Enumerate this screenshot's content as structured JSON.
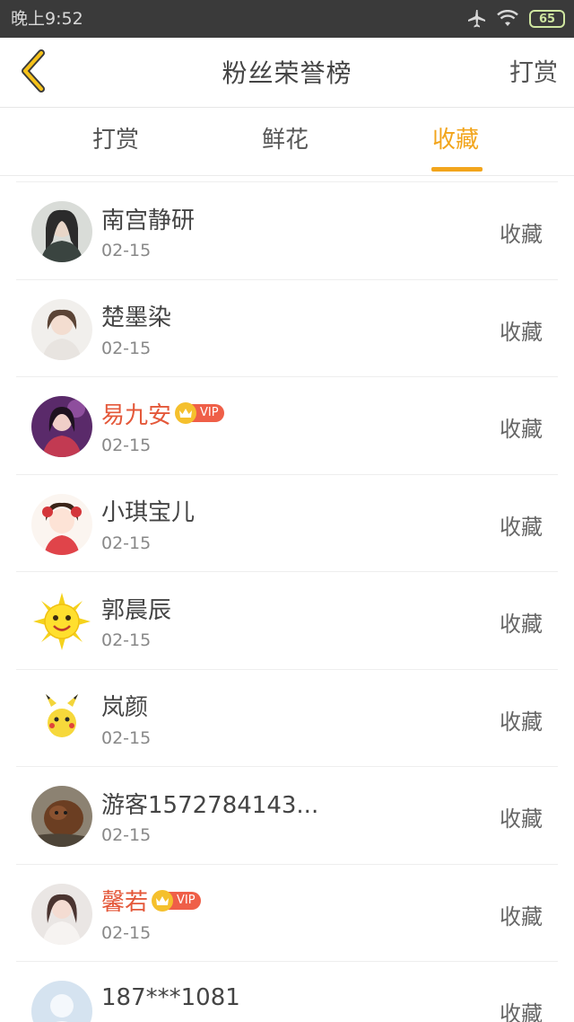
{
  "status_bar": {
    "time": "晚上9:52",
    "battery": "65"
  },
  "header": {
    "title": "粉丝荣誉榜",
    "action_label": "打赏"
  },
  "tabs": [
    {
      "label": "打赏",
      "active": false
    },
    {
      "label": "鲜花",
      "active": false
    },
    {
      "label": "收藏",
      "active": true
    }
  ],
  "colors": {
    "accent": "#f2a51c",
    "vip_name": "#e4583a",
    "vip_badge": "#ef5f48"
  },
  "rows": [
    {
      "name": "南宫静研",
      "date": "02-15",
      "action": "收藏",
      "vip": false
    },
    {
      "name": "楚墨染",
      "date": "02-15",
      "action": "收藏",
      "vip": false
    },
    {
      "name": "易九安",
      "date": "02-15",
      "action": "收藏",
      "vip": true,
      "badge": "VIP"
    },
    {
      "name": "小琪宝儿",
      "date": "02-15",
      "action": "收藏",
      "vip": false
    },
    {
      "name": "郭晨辰",
      "date": "02-15",
      "action": "收藏",
      "vip": false
    },
    {
      "name": "岚颜",
      "date": "02-15",
      "action": "收藏",
      "vip": false
    },
    {
      "name": "游客1572784143...",
      "date": "02-15",
      "action": "收藏",
      "vip": false
    },
    {
      "name": "馨若",
      "date": "02-15",
      "action": "收藏",
      "vip": true,
      "badge": "VIP"
    },
    {
      "name": "187***1081",
      "date": "",
      "action": "收藏",
      "vip": false
    }
  ]
}
